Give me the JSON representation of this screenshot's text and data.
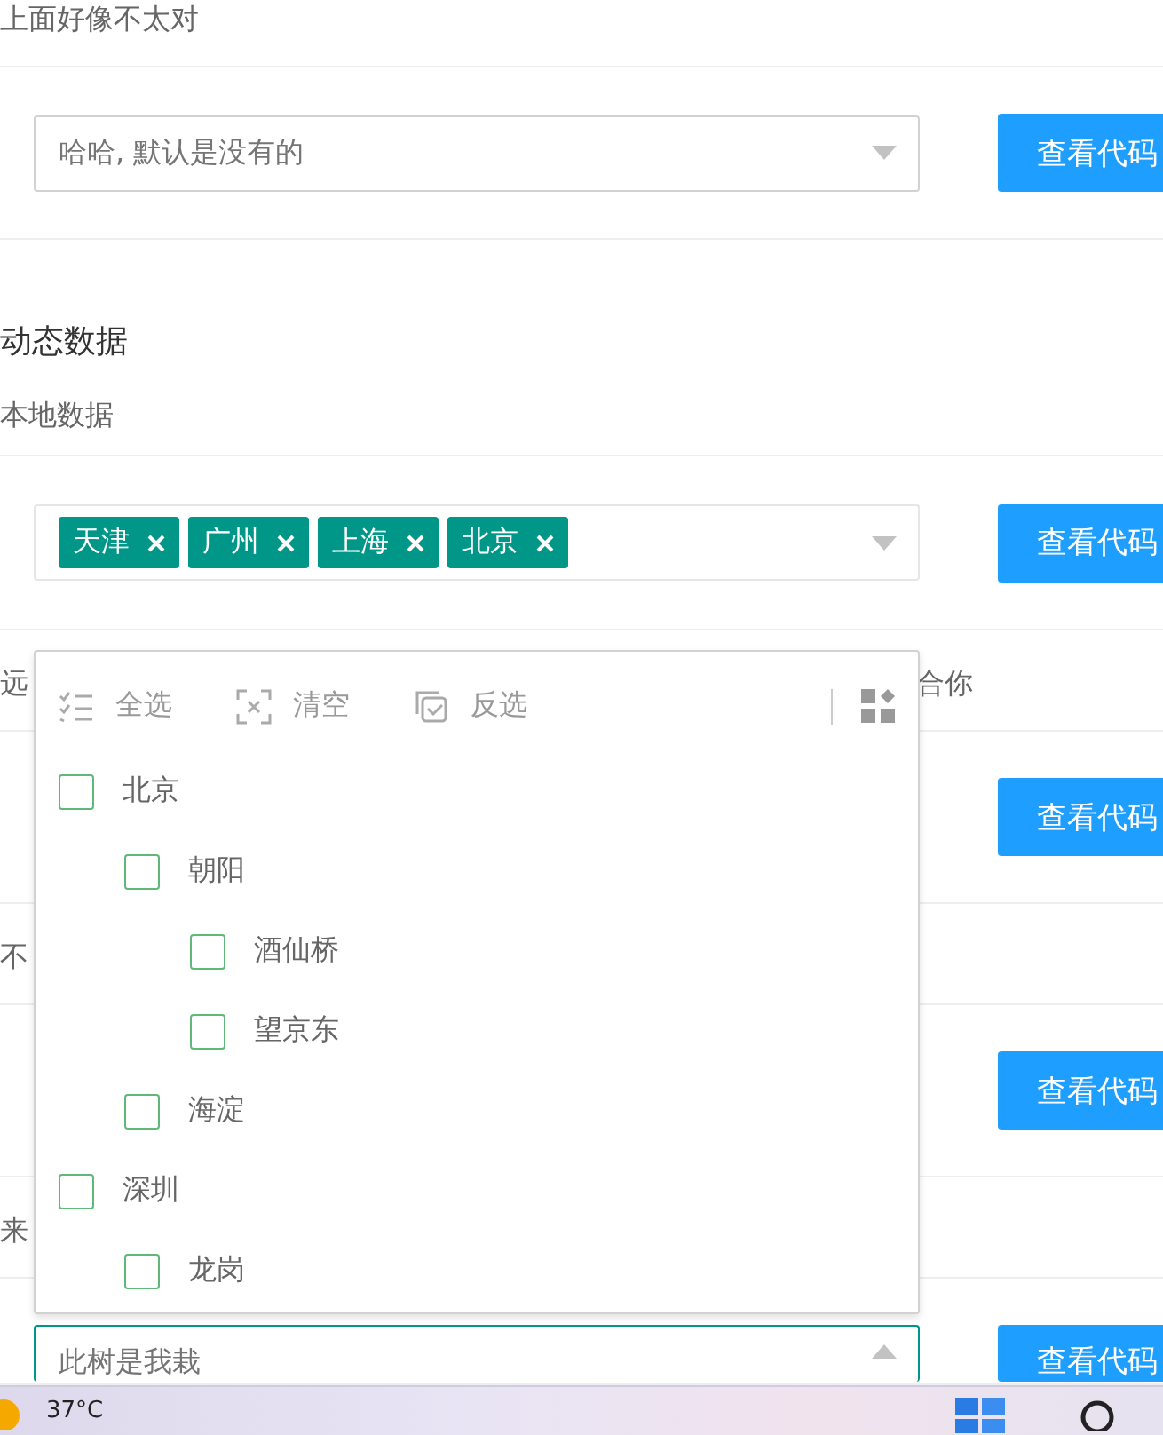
{
  "sections": [
    {
      "kind": "note",
      "text": "上面好像不太对"
    },
    {
      "kind": "select",
      "placeholder": "哈哈, 默认是没有的",
      "open": false,
      "button": "查看代码"
    },
    {
      "kind": "heading",
      "title": "动态数据",
      "text": "本地数据"
    },
    {
      "kind": "tags",
      "tags": [
        {
          "label": "天津"
        },
        {
          "label": "广州"
        },
        {
          "label": "上海"
        },
        {
          "label": "北京"
        }
      ],
      "open": false,
      "button": "查看代码"
    },
    {
      "kind": "note",
      "text": "远",
      "trailing": "合你"
    },
    {
      "kind": "button",
      "button": "查看代码"
    },
    {
      "kind": "note",
      "text": "不"
    },
    {
      "kind": "button",
      "button": "查看代码"
    },
    {
      "kind": "note",
      "text": "来"
    },
    {
      "kind": "select",
      "value": "此树是我栽",
      "open": true,
      "button": "查看代码"
    }
  ],
  "dropdown": {
    "toolbar": [
      {
        "kind": "all",
        "label": "全选"
      },
      {
        "kind": "clear",
        "label": "清空"
      },
      {
        "kind": "invert",
        "label": "反选"
      }
    ],
    "tree": [
      {
        "label": "北京",
        "checked": false,
        "children": [
          {
            "label": "朝阳",
            "checked": false,
            "children": [
              {
                "label": "酒仙桥",
                "checked": false
              },
              {
                "label": "望京东",
                "checked": false
              }
            ]
          },
          {
            "label": "海淀",
            "checked": false
          }
        ]
      },
      {
        "label": "深圳",
        "checked": false,
        "children": [
          {
            "label": "龙岗",
            "checked": false
          }
        ]
      }
    ]
  },
  "taskbar": {
    "weather": "37°C"
  }
}
